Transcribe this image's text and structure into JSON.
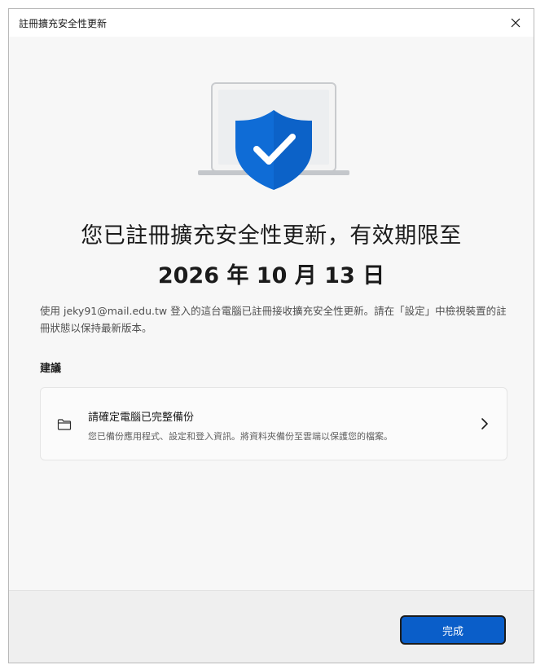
{
  "window": {
    "title": "註冊擴充安全性更新"
  },
  "hero": {
    "icon": "laptop-shield-check-icon",
    "shield_color": "#0f6cd6"
  },
  "headline": {
    "line1": "您已註冊擴充安全性更新，有效期限至",
    "line2": "2026 年 10 月 13 日"
  },
  "description": "使用 jeky91@mail.edu.tw 登入的這台電腦已註冊接收擴充安全性更新。請在「設定」中檢視裝置的註冊狀態以保持最新版本。",
  "recommendations": {
    "label": "建議",
    "items": [
      {
        "icon": "folder-icon",
        "title": "請確定電腦已完整備份",
        "subtitle": "您已備份應用程式、設定和登入資訊。將資料夾備份至雲端以保護您的檔案。"
      }
    ]
  },
  "footer": {
    "done_label": "完成"
  },
  "colors": {
    "accent": "#0a5ec9"
  }
}
